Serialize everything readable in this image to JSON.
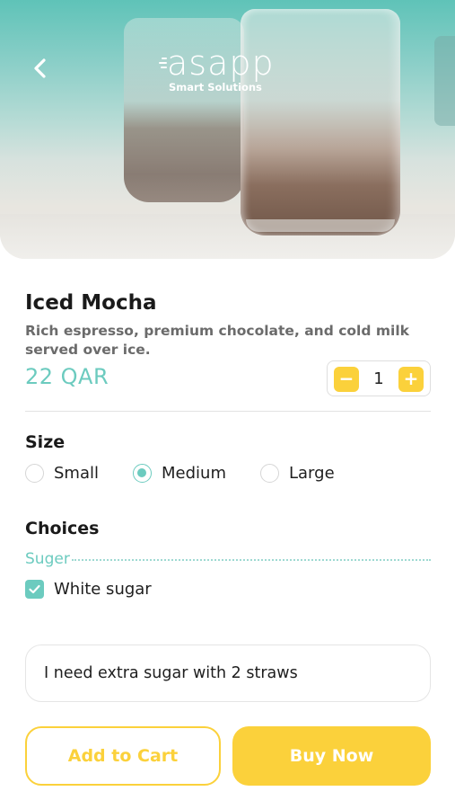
{
  "header": {
    "logo_text": "asapp",
    "logo_tagline": "Smart Solutions",
    "back_icon": "chevron-left-icon"
  },
  "product": {
    "name": "Iced Mocha",
    "description": "Rich espresso, premium chocolate, and cold milk served over ice.",
    "price": "22 QAR",
    "quantity": "1",
    "minus_label": "−",
    "plus_label": "+"
  },
  "size": {
    "title": "Size",
    "options": [
      "Small",
      "Medium",
      "Large"
    ],
    "selected": "Medium"
  },
  "choices": {
    "title": "Choices",
    "group_label": "Suger",
    "items": [
      {
        "label": "White sugar",
        "checked": true
      }
    ]
  },
  "note": {
    "value": "I need extra sugar with 2 straws"
  },
  "actions": {
    "add_to_cart": "Add to Cart",
    "buy_now": "Buy Now"
  },
  "colors": {
    "accent": "#6ccbbf",
    "button": "#fbd13b"
  }
}
